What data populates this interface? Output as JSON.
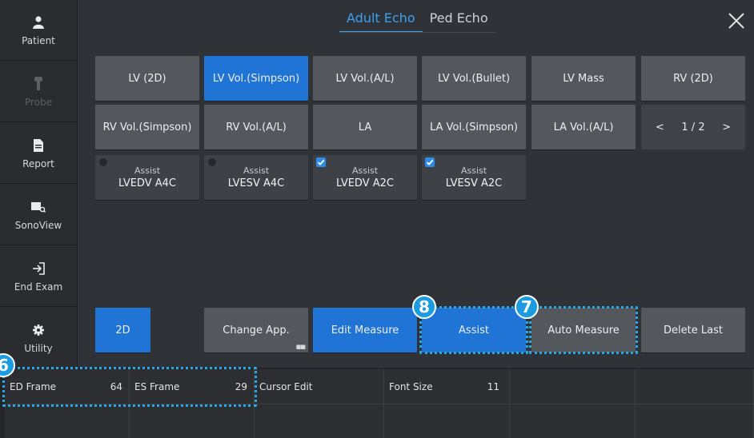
{
  "sidebar": {
    "items": [
      {
        "label": "Patient",
        "icon": "person-icon",
        "disabled": false
      },
      {
        "label": "Probe",
        "icon": "probe-icon",
        "disabled": true
      },
      {
        "label": "Report",
        "icon": "document-icon",
        "disabled": false
      },
      {
        "label": "SonoView",
        "icon": "sonoview-icon",
        "disabled": false
      },
      {
        "label": "End Exam",
        "icon": "exit-icon",
        "disabled": false
      },
      {
        "label": "Utility",
        "icon": "gear-icon",
        "disabled": false
      }
    ]
  },
  "tabs": [
    {
      "label": "Adult Echo",
      "active": true
    },
    {
      "label": "Ped Echo",
      "active": false
    }
  ],
  "measures": {
    "row1": [
      "LV (2D)",
      "LV Vol.(Simpson)",
      "LV Vol.(A/L)",
      "LV Vol.(Bullet)",
      "LV Mass",
      "RV (2D)"
    ],
    "row2": [
      "RV Vol.(Simpson)",
      "RV Vol.(A/L)",
      "LA",
      "LA Vol.(Simpson)",
      "LA Vol.(A/L)"
    ],
    "selected": "LV Vol.(Simpson)",
    "pager": {
      "text": "1 / 2",
      "prev": "<",
      "next": ">"
    }
  },
  "assist_items": [
    {
      "sub": "Assist",
      "main": "LVEDV A4C",
      "checked": false
    },
    {
      "sub": "Assist",
      "main": "LVESV A4C",
      "checked": false
    },
    {
      "sub": "Assist",
      "main": "LVEDV A2C",
      "checked": true
    },
    {
      "sub": "Assist",
      "main": "LVESV A2C",
      "checked": true
    }
  ],
  "actions": {
    "mode": "2D",
    "change_app": "Change App.",
    "edit_measure": "Edit Measure",
    "assist": "Assist",
    "auto_measure": "Auto Measure",
    "delete_last": "Delete Last"
  },
  "callouts": {
    "six": "6",
    "seven": "7",
    "eight": "8"
  },
  "softkeys": [
    {
      "label": "ED Frame",
      "value": "64"
    },
    {
      "label": "ES Frame",
      "value": "29"
    },
    {
      "label": "Cursor Edit",
      "value": ""
    },
    {
      "label": "Font Size",
      "value": "11"
    }
  ],
  "colors": {
    "accent": "#1f74d6",
    "highlight": "#27a9e6",
    "button": "#54575c",
    "background": "#2f3236"
  }
}
